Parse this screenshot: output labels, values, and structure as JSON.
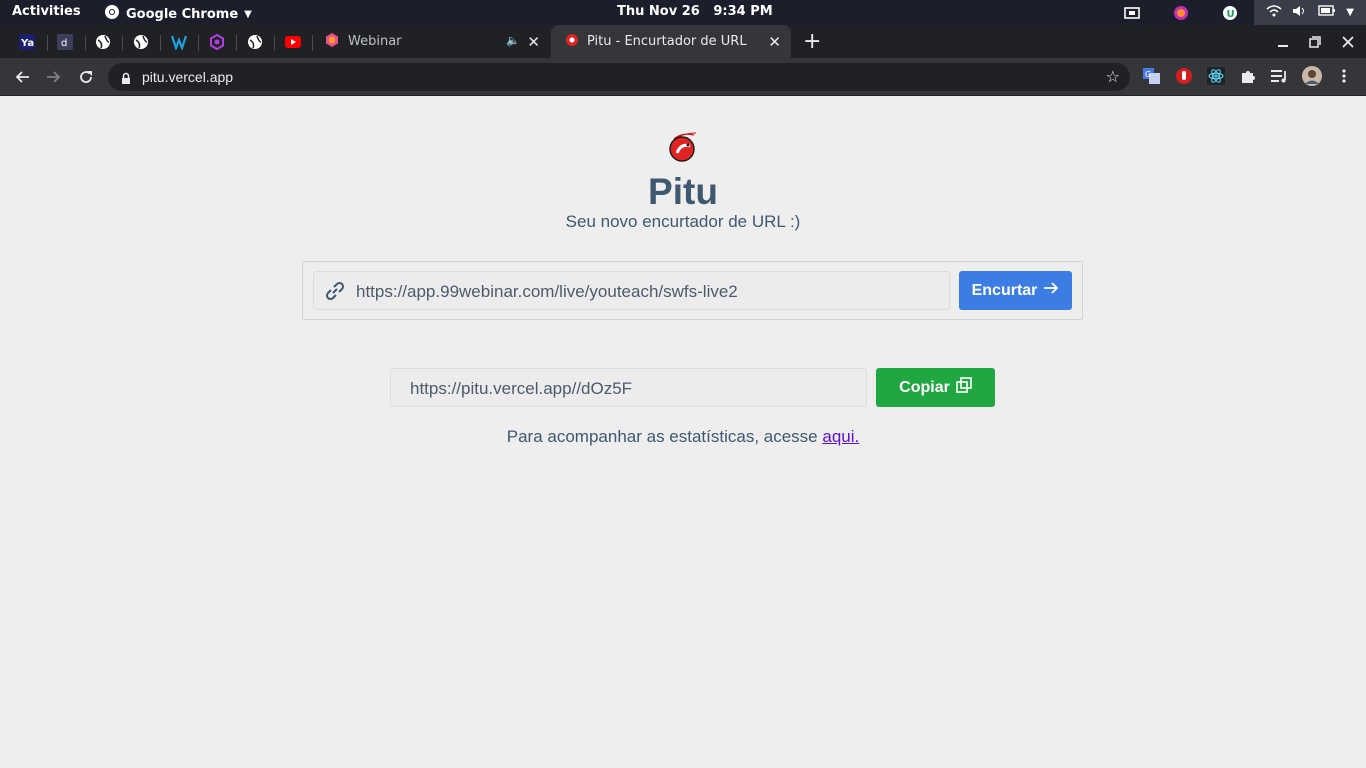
{
  "gnome": {
    "activities": "Activities",
    "app_name": "Google Chrome",
    "clock": "Thu Nov 26   9:34 PM"
  },
  "tabs": [
    {
      "label": "Webinar",
      "muted": true
    },
    {
      "label": "Pitu - Encurtador de URL",
      "active": true
    }
  ],
  "omnibox": {
    "url": "pitu.vercel.app"
  },
  "page": {
    "title": "Pitu",
    "subtitle": "Seu novo encurtador de URL :)",
    "url_input_value": "https://app.99webinar.com/live/youteach/swfs-live2",
    "shorten_button": "Encurtar",
    "short_url_value": "https://pitu.vercel.app//dOz5F",
    "copy_button": "Copiar",
    "stats_text": "Para acompanhar as estatísticas, acesse ",
    "stats_link": "aqui."
  },
  "colors": {
    "accent_blue": "#3b7de3",
    "accent_green": "#21a742",
    "title_color": "#3e586f",
    "link_color": "#5a12d6"
  },
  "icons": [
    "chrome-icon",
    "lock-icon",
    "star-icon",
    "link-icon",
    "arrow-right-icon",
    "copy-icon",
    "pitu-logo"
  ]
}
